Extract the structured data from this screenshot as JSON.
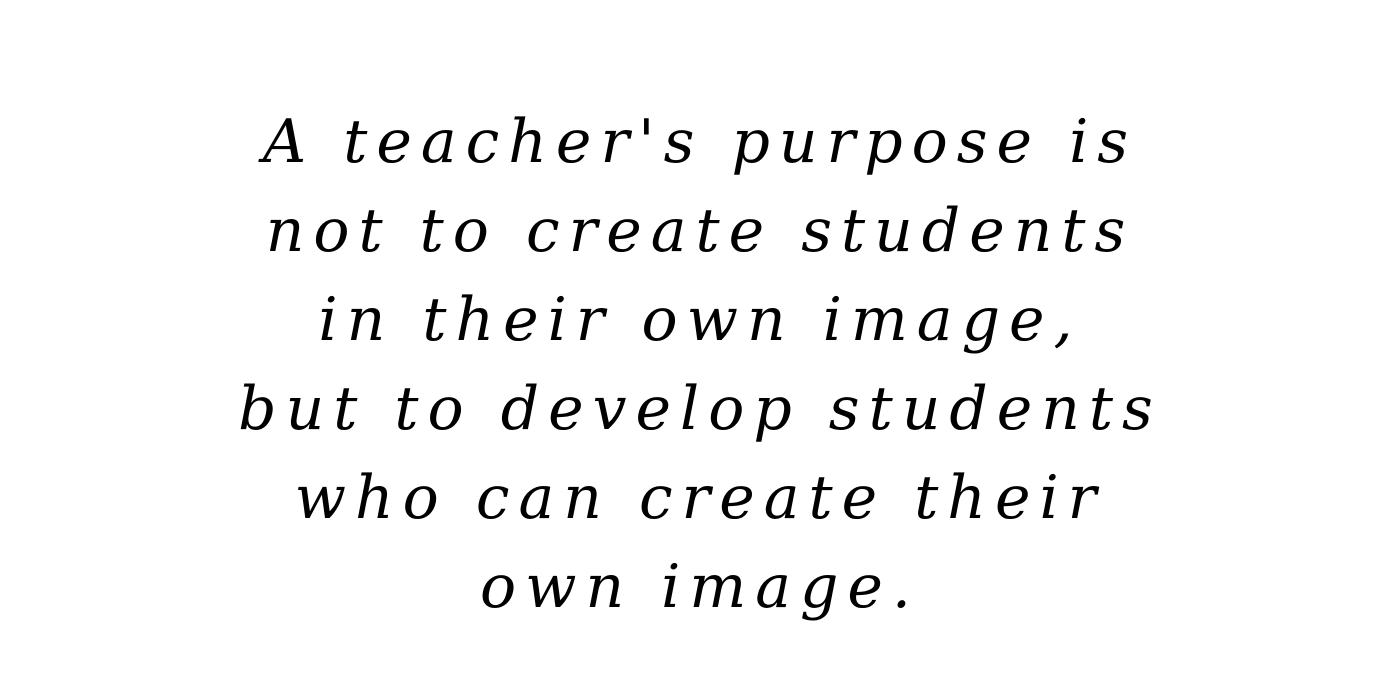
{
  "quote": {
    "lines": [
      "A teacher's purpose is",
      "not to create students",
      "in their own image,",
      "but to develop students",
      "who can create their",
      "own image."
    ]
  },
  "colors": {
    "background": "#ffffff",
    "text": "#000000"
  }
}
